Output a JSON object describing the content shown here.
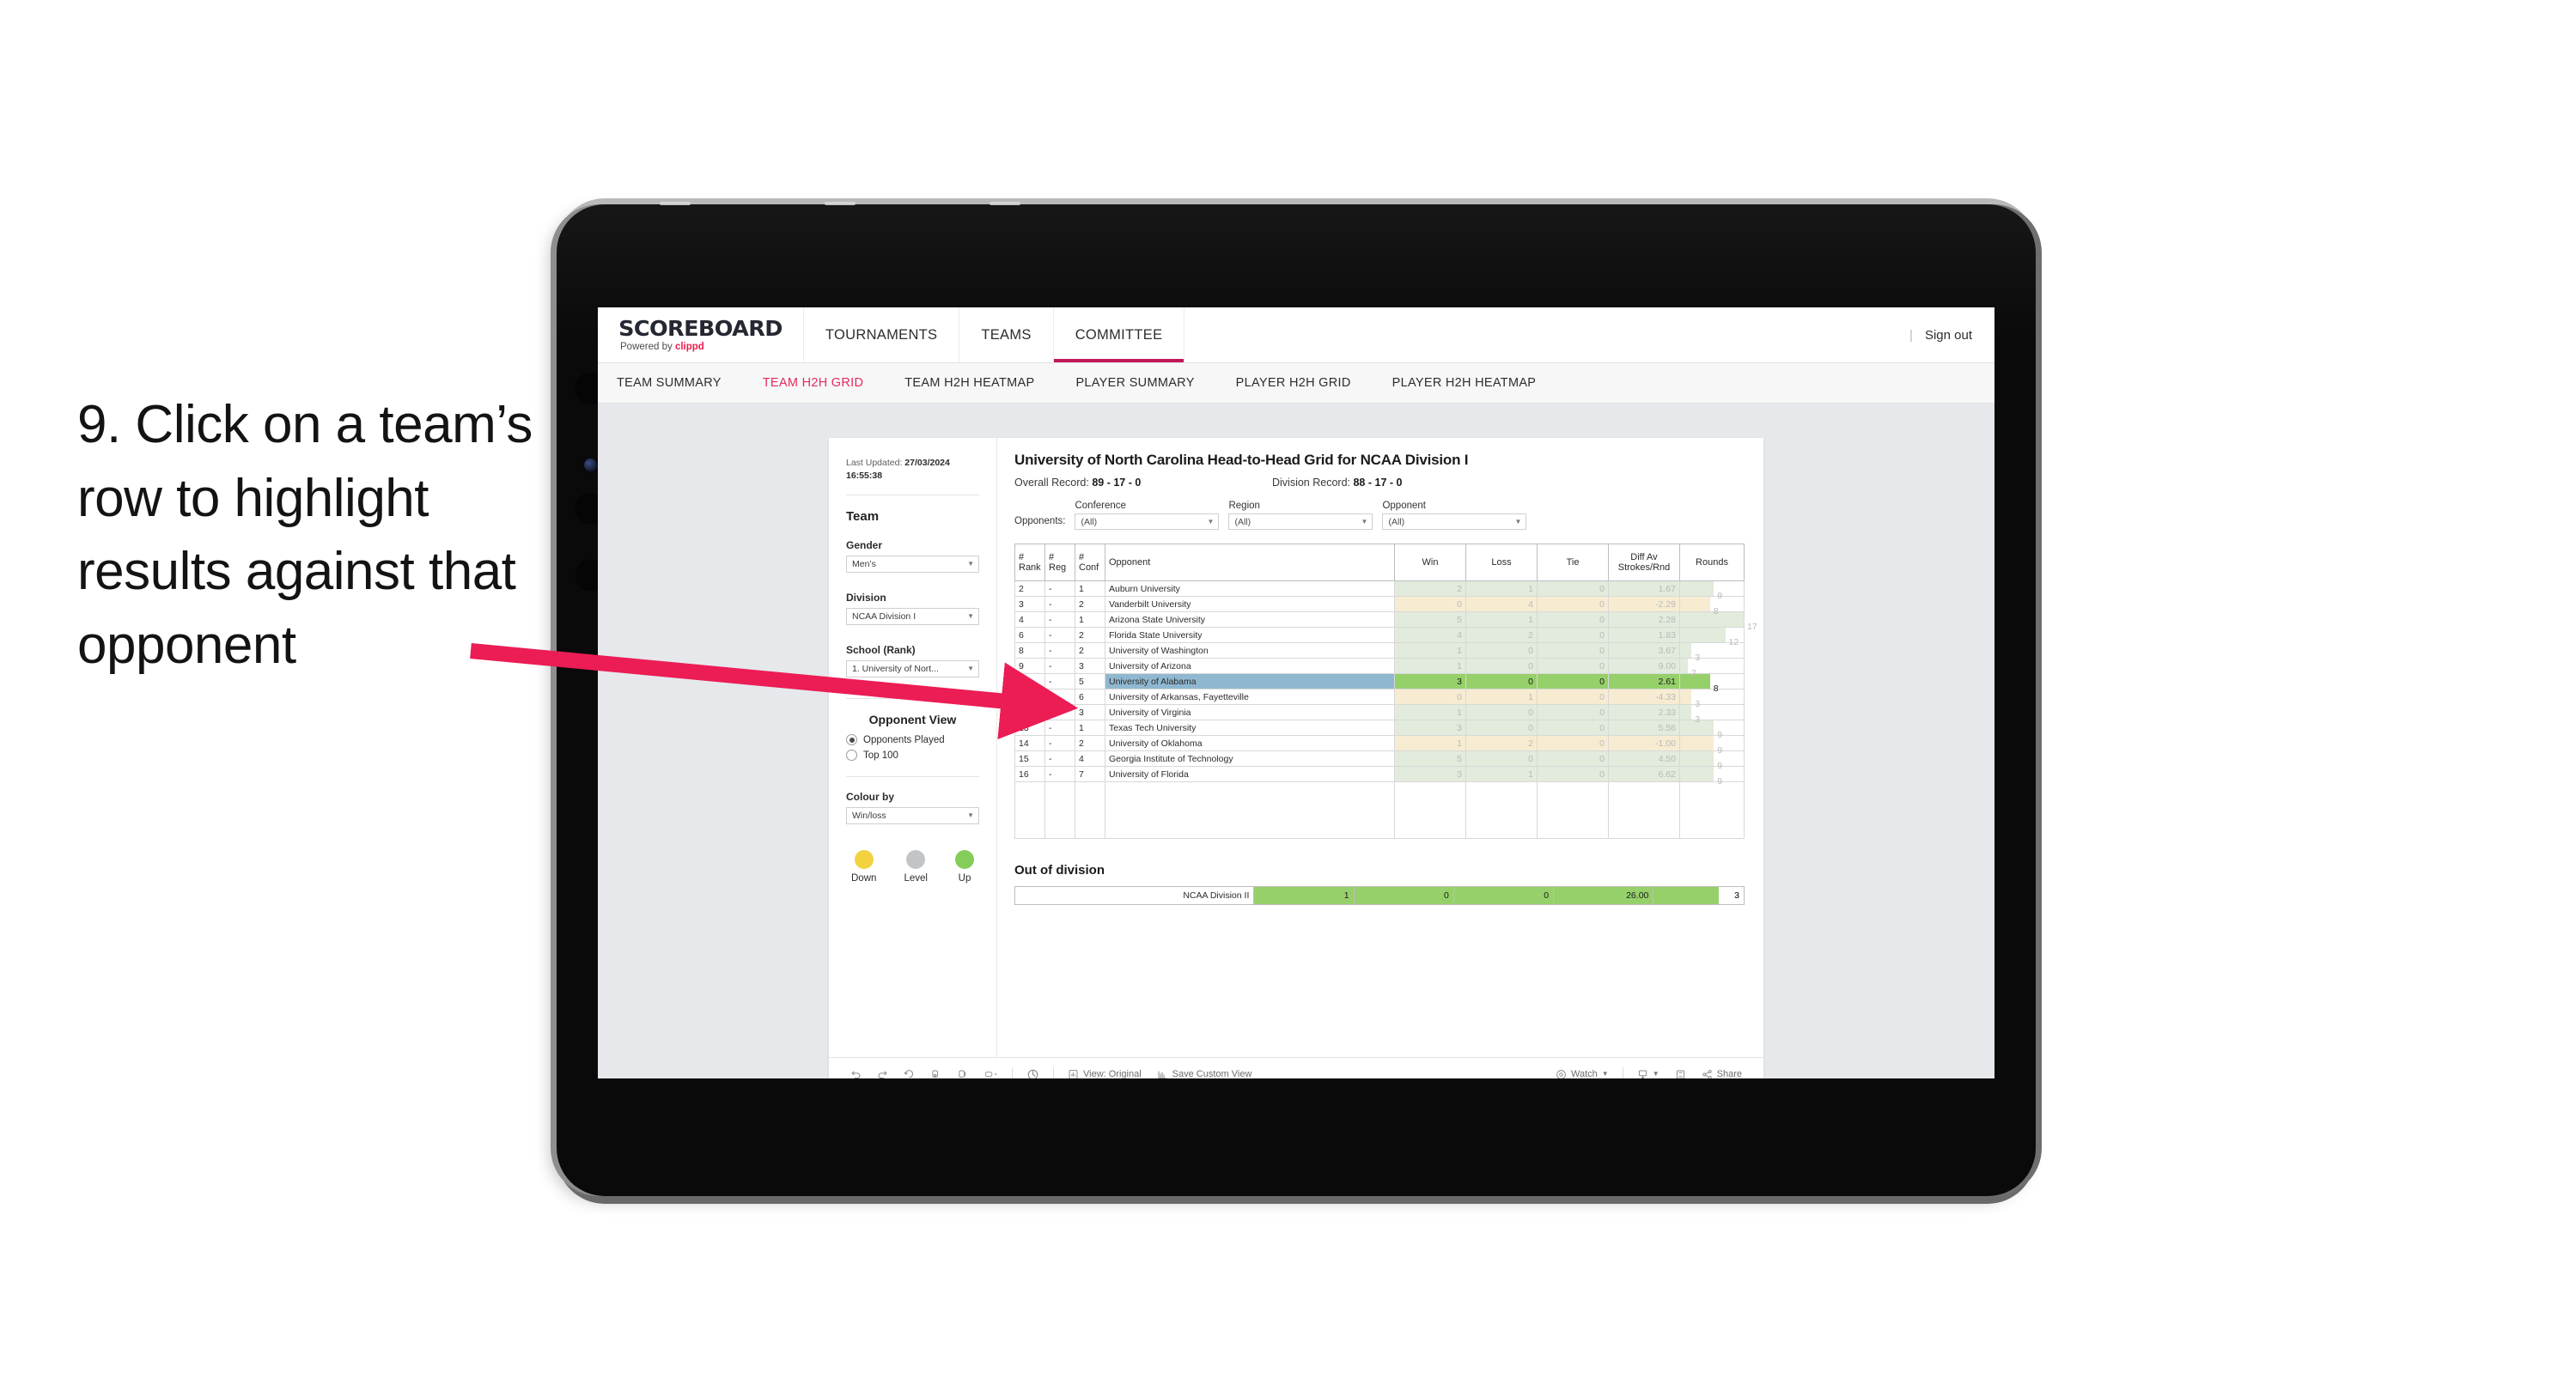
{
  "caption": {
    "text": "9. Click on a team’s row to highlight results against that opponent"
  },
  "brand": {
    "name": "SCOREBOARD",
    "tagline_prefix": "Powered by ",
    "tagline_brand": "clippd",
    "accent": "#ec1c4b"
  },
  "topnav": {
    "items": [
      {
        "label": "TOURNAMENTS",
        "active": false
      },
      {
        "label": "TEAMS",
        "active": false
      },
      {
        "label": "COMMITTEE",
        "active": true
      }
    ],
    "divider": "|",
    "signout": "Sign out"
  },
  "subnav": {
    "items": [
      {
        "label": "TEAM SUMMARY",
        "active": false
      },
      {
        "label": "TEAM H2H GRID",
        "active": true
      },
      {
        "label": "TEAM H2H HEATMAP",
        "active": false
      },
      {
        "label": "PLAYER SUMMARY",
        "active": false
      },
      {
        "label": "PLAYER H2H GRID",
        "active": false
      },
      {
        "label": "PLAYER H2H HEATMAP",
        "active": false
      }
    ]
  },
  "pane": {
    "last_updated_label": "Last Updated: ",
    "last_updated_value": "27/03/2024 16:55:38",
    "team_heading": "Team",
    "gender_label": "Gender",
    "gender_value": "Men’s",
    "division_label": "Division",
    "division_value": "NCAA Division I",
    "school_label": "School (Rank)",
    "school_value": "1. University of Nort...",
    "opponent_view_heading": "Opponent View",
    "opponent_view_options": [
      {
        "label": "Opponents Played",
        "selected": true
      },
      {
        "label": "Top 100",
        "selected": false
      }
    ],
    "colour_by_label": "Colour by",
    "colour_by_value": "Win/loss",
    "legend": [
      {
        "label": "Down",
        "color": "#f2d23f"
      },
      {
        "label": "Level",
        "color": "#c2c5c7"
      },
      {
        "label": "Up",
        "color": "#86cc5b"
      }
    ]
  },
  "viz": {
    "title": "University of North Carolina Head-to-Head Grid for NCAA Division I",
    "overall_record_label": "Overall Record: ",
    "overall_record_value": "89 - 17 - 0",
    "division_record_label": "Division Record: ",
    "division_record_value": "88 - 17 - 0",
    "opponents_label": "Opponents:",
    "filters": [
      {
        "label": "Conference",
        "value": "(All)"
      },
      {
        "label": "Region",
        "value": "(All)"
      },
      {
        "label": "Opponent",
        "value": "(All)"
      }
    ],
    "columns": [
      "# Rank",
      "# Reg",
      "# Conf",
      "Opponent",
      "Win",
      "Loss",
      "Tie",
      "Diff Av Strokes/Rnd",
      "Rounds"
    ],
    "column_head": {
      "rank_top": "#",
      "rank_bot": "Rank",
      "reg_top": "#",
      "reg_bot": "Reg",
      "conf_top": "#",
      "conf_bot": "Conf",
      "opponent": "Opponent",
      "win": "Win",
      "loss": "Loss",
      "tie": "Tie",
      "diff_top": "Diff Av",
      "diff_bot": "Strokes/Rnd",
      "rounds": "Rounds"
    },
    "out_of_division_title": "Out of division",
    "out_of_division": {
      "label": "NCAA Division II",
      "win": "1",
      "loss": "0",
      "tie": "0",
      "diff": "26.00",
      "rounds": "3"
    }
  },
  "chart_data": {
    "type": "table",
    "title": "University of North Carolina Head-to-Head Grid for NCAA Division I",
    "columns": [
      "#Rank",
      "#Reg",
      "#Conf",
      "Opponent",
      "Win",
      "Loss",
      "Tie",
      "Diff Av Strokes/Rnd",
      "Rounds"
    ],
    "rows": [
      {
        "rank": "2",
        "reg": "-",
        "conf": "1",
        "opponent": "Auburn University",
        "win": "2",
        "loss": "1",
        "tie": "0",
        "diff": "1.67",
        "rounds": "9",
        "tone": "up",
        "selected": false
      },
      {
        "rank": "3",
        "reg": "-",
        "conf": "2",
        "opponent": "Vanderbilt University",
        "win": "0",
        "loss": "4",
        "tie": "0",
        "diff": "-2.29",
        "rounds": "8",
        "tone": "down",
        "selected": false
      },
      {
        "rank": "4",
        "reg": "-",
        "conf": "1",
        "opponent": "Arizona State University",
        "win": "5",
        "loss": "1",
        "tie": "0",
        "diff": "2.28",
        "rounds": "17",
        "tone": "up",
        "selected": false
      },
      {
        "rank": "6",
        "reg": "-",
        "conf": "2",
        "opponent": "Florida State University",
        "win": "4",
        "loss": "2",
        "tie": "0",
        "diff": "1.83",
        "rounds": "12",
        "tone": "up",
        "selected": false
      },
      {
        "rank": "8",
        "reg": "-",
        "conf": "2",
        "opponent": "University of Washington",
        "win": "1",
        "loss": "0",
        "tie": "0",
        "diff": "3.67",
        "rounds": "3",
        "tone": "up",
        "selected": false
      },
      {
        "rank": "9",
        "reg": "-",
        "conf": "3",
        "opponent": "University of Arizona",
        "win": "1",
        "loss": "0",
        "tie": "0",
        "diff": "9.00",
        "rounds": "2",
        "tone": "up",
        "selected": false
      },
      {
        "rank": "10",
        "reg": "-",
        "conf": "5",
        "opponent": "University of Alabama",
        "win": "3",
        "loss": "0",
        "tie": "0",
        "diff": "2.61",
        "rounds": "8",
        "tone": "up",
        "selected": true
      },
      {
        "rank": "11",
        "reg": "-",
        "conf": "6",
        "opponent": "University of Arkansas, Fayetteville",
        "win": "0",
        "loss": "1",
        "tie": "0",
        "diff": "-4.33",
        "rounds": "3",
        "tone": "down",
        "selected": false
      },
      {
        "rank": "12",
        "reg": "-",
        "conf": "3",
        "opponent": "University of Virginia",
        "win": "1",
        "loss": "0",
        "tie": "0",
        "diff": "2.33",
        "rounds": "3",
        "tone": "up",
        "selected": false
      },
      {
        "rank": "13",
        "reg": "-",
        "conf": "1",
        "opponent": "Texas Tech University",
        "win": "3",
        "loss": "0",
        "tie": "0",
        "diff": "5.56",
        "rounds": "9",
        "tone": "up",
        "selected": false
      },
      {
        "rank": "14",
        "reg": "-",
        "conf": "2",
        "opponent": "University of Oklahoma",
        "win": "1",
        "loss": "2",
        "tie": "0",
        "diff": "-1.00",
        "rounds": "9",
        "tone": "down",
        "selected": false
      },
      {
        "rank": "15",
        "reg": "-",
        "conf": "4",
        "opponent": "Georgia Institute of Technology",
        "win": "5",
        "loss": "0",
        "tie": "0",
        "diff": "4.50",
        "rounds": "9",
        "tone": "up",
        "selected": false
      },
      {
        "rank": "16",
        "reg": "-",
        "conf": "7",
        "opponent": "University of Florida",
        "win": "3",
        "loss": "1",
        "tie": "0",
        "diff": "6.62",
        "rounds": "9",
        "tone": "up",
        "selected": false
      }
    ],
    "out_of_division_rows": [
      {
        "label": "NCAA Division II",
        "win": "1",
        "loss": "0",
        "tie": "0",
        "diff": "26.00",
        "rounds": "3"
      }
    ],
    "colors": {
      "up": "#e2ebdc",
      "down": "#f7ecd2",
      "selected_bar": "#96d06a",
      "selected_name": "#8fb8d0"
    }
  },
  "toolbar": {
    "view_label": "View: Original",
    "save_label": "Save Custom View",
    "watch_label": "Watch",
    "share_label": "Share"
  }
}
